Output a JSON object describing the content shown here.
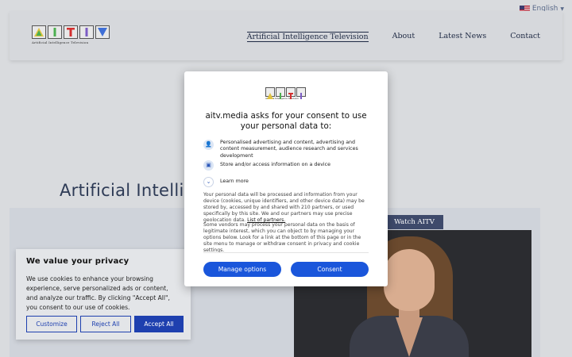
{
  "language": {
    "label": "English"
  },
  "site": {
    "logo_text": "AITV",
    "logo_subtitle": "Artificial Intelligence Television",
    "nav": [
      "Artificial Intelligence Television",
      "About",
      "Latest News",
      "Contact"
    ],
    "hero_title": "Artificial Intellig",
    "watch_label": "Watch AITV"
  },
  "cookie_banner": {
    "title": "We value your privacy",
    "body": "We use cookies to enhance your browsing experience, serve personalized ads or content, and analyze our traffic. By clicking \"Accept All\", you consent to our use of cookies.",
    "customize": "Customize",
    "reject": "Reject All",
    "accept": "Accept All"
  },
  "consent_dialog": {
    "title": "aitv.media asks for your consent to use your personal data to:",
    "purposes": [
      "Personalised advertising and content, advertising and content measurement, audience research and services development",
      "Store and/or access information on a device",
      "Learn more"
    ],
    "paragraph1": "Your personal data will be processed and information from your device (cookies, unique identifiers, and other device data) may be stored by, accessed by and shared with 210 partners, or used specifically by this site. We and our partners may use precise geolocation data.",
    "partners_link": "List of partners.",
    "paragraph2": "Some vendors may process your personal data on the basis of legitimate interest, which you can object to by managing your options below. Look for a link at the bottom of this page or in the site menu to manage or withdraw consent in privacy and cookie settings.",
    "manage_options": "Manage options",
    "consent": "Consent"
  }
}
